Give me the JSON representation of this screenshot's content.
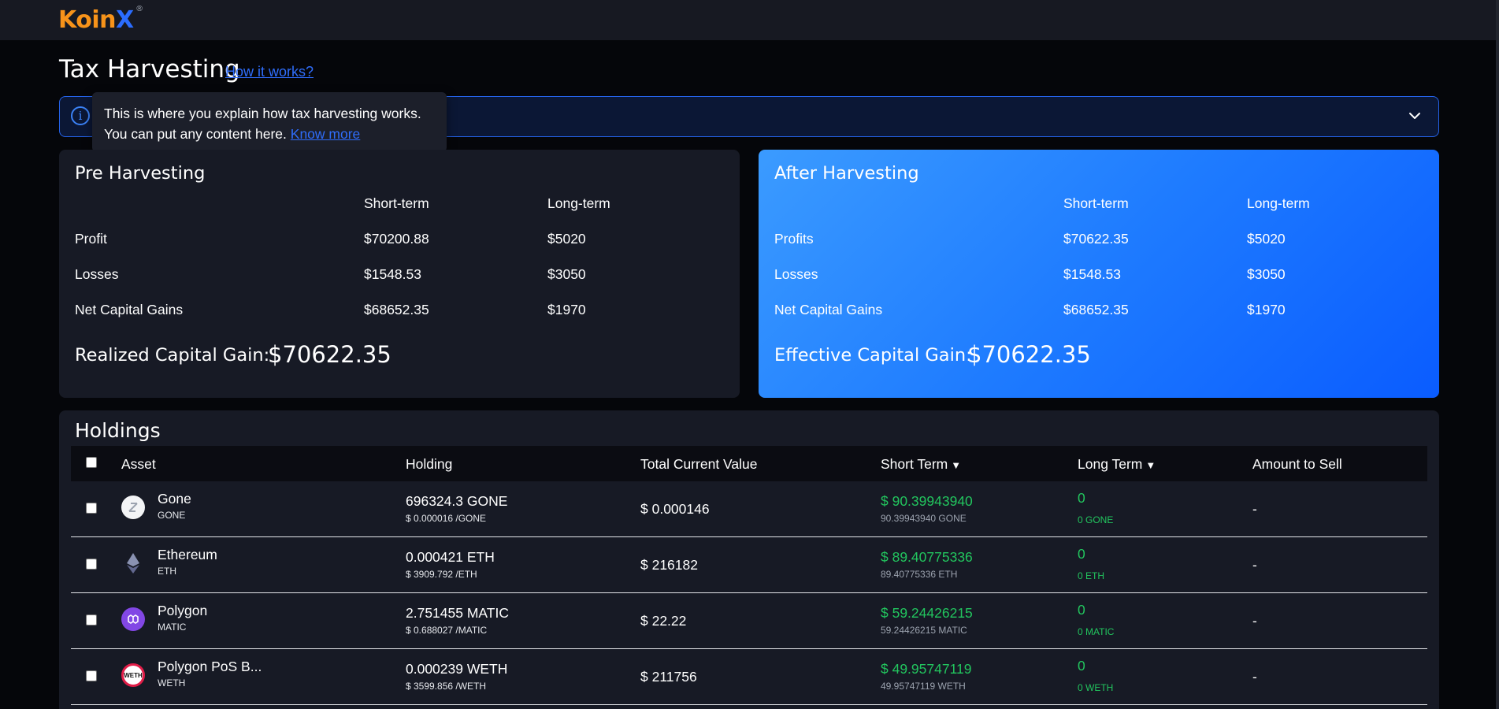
{
  "header": {
    "logo_text_main": "Koin",
    "logo_text_x": "X",
    "logo_reg": "®"
  },
  "page": {
    "title": "Tax Harvesting",
    "how_link": "How it works?"
  },
  "tooltip": {
    "line1": "This is where you explain how tax harvesting works.",
    "line2": "You can put any content here.",
    "know_more": "Know more"
  },
  "banner": {
    "info_icon": "info-icon",
    "chevron_icon": "chevron-down-icon"
  },
  "pre_harvesting": {
    "title": "Pre Harvesting",
    "col_short": "Short-term",
    "col_long": "Long-term",
    "rows": [
      {
        "label": "Profit",
        "short": "$70200.88",
        "long": "$5020"
      },
      {
        "label": "Losses",
        "short": "$1548.53",
        "long": "$3050"
      },
      {
        "label": "Net Capital Gains",
        "short": "$68652.35",
        "long": "$1970"
      }
    ],
    "gain_label": "Realized Capital Gain:",
    "gain_value": "$70622.35"
  },
  "after_harvesting": {
    "title": "After Harvesting",
    "col_short": "Short-term",
    "col_long": "Long-term",
    "rows": [
      {
        "label": "Profits",
        "short": "$70622.35",
        "long": "$5020"
      },
      {
        "label": "Losses",
        "short": "$1548.53",
        "long": "$3050"
      },
      {
        "label": "Net Capital Gains",
        "short": "$68652.35",
        "long": "$1970"
      }
    ],
    "gain_label": "Effective Capital Gain:",
    "gain_value": "$70622.35"
  },
  "holdings": {
    "title": "Holdings",
    "columns": {
      "asset": "Asset",
      "holding": "Holding",
      "total": "Total Current Value",
      "short": "Short Term",
      "long": "Long Term",
      "sell": "Amount to Sell",
      "sort_glyph": "▼"
    },
    "rows": [
      {
        "name": "Gone",
        "symbol": "GONE",
        "icon": "gone-coin-icon",
        "holding": "696324.3 GONE",
        "price": "$ 0.000016 /GONE",
        "total": "$ 0.000146",
        "short_value": "$ 90.39943940",
        "short_units": "90.39943940 GONE",
        "long_value": "0",
        "long_units": "0 GONE",
        "sell": "-"
      },
      {
        "name": "Ethereum",
        "symbol": "ETH",
        "icon": "ethereum-icon",
        "holding": "0.000421 ETH",
        "price": "$ 3909.792 /ETH",
        "total": "$ 216182",
        "short_value": "$ 89.40775336",
        "short_units": "89.40775336 ETH",
        "long_value": "0",
        "long_units": "0 ETH",
        "sell": "-"
      },
      {
        "name": "Polygon",
        "symbol": "MATIC",
        "icon": "polygon-icon",
        "holding": "2.751455 MATIC",
        "price": "$ 0.688027 /MATIC",
        "total": "$ 22.22",
        "short_value": "$ 59.24426215",
        "short_units": "59.24426215 MATIC",
        "long_value": "0",
        "long_units": "0 MATIC",
        "sell": "-"
      },
      {
        "name": "Polygon PoS B...",
        "symbol": "WETH",
        "icon": "weth-icon",
        "icon_text": "WETH",
        "holding": "0.000239 WETH",
        "price": "$ 3599.856 /WETH",
        "total": "$ 211756",
        "short_value": "$ 49.95747119",
        "short_units": "49.95747119 WETH",
        "long_value": "0",
        "long_units": "0 WETH",
        "sell": "-"
      }
    ]
  },
  "colors": {
    "background": "#05060a",
    "card": "#171a25",
    "accent_blue": "#2f6dfb",
    "gain_green": "#22c55e",
    "logo_orange": "#f7931a"
  }
}
